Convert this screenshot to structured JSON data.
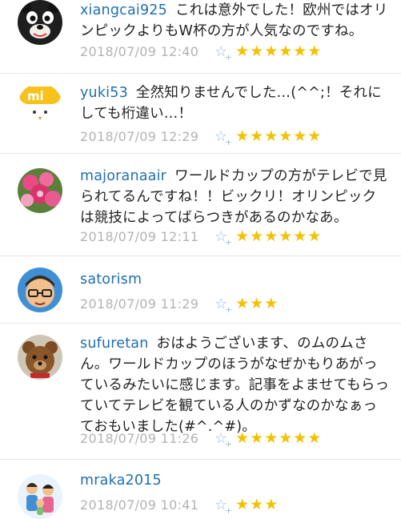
{
  "comments": [
    {
      "user": "xiangcai925",
      "text": "これは意外でした！欧州ではオリンピックよりもW杯の方が人気なのですね。",
      "date": "2018/07/09 12:40",
      "stars": "★★★★★★"
    },
    {
      "user": "yuki53",
      "text": "全然知りませんでした…(^^;！それにしても桁違い…！",
      "date": "2018/07/09 12:29",
      "stars": "★★★★★★"
    },
    {
      "user": "majoranaair",
      "text": "ワールドカップの方がテレビで見られてるんですね！！ビックリ！オリンピックは競技によってばらつきがあるのかなあ。",
      "date": "2018/07/09 12:11",
      "stars": "★★★★★★"
    },
    {
      "user": "satorism",
      "text": "",
      "date": "2018/07/09 11:29",
      "stars": "★★★"
    },
    {
      "user": "sufuretan",
      "text": "おはようございます、のムのムさん。ワールドカップのほうがなぜかもりあがっているみたいに感じます。記事をよませてもらっていてテレビを観ている人のかずなのかなぁっておもいました(#^.^#)。",
      "date": "2018/07/09 11:26",
      "stars": "★★★★★★"
    },
    {
      "user": "mraka2015",
      "text": "",
      "date": "2018/07/09 10:41",
      "stars": "★★★"
    }
  ],
  "avatar_icons": [
    "bear-avatar-icon",
    "mi-chick-avatar-icon",
    "flower-avatar-icon",
    "glasses-man-avatar-icon",
    "teddy-bear-avatar-icon",
    "family-avatar-icon"
  ],
  "colors": {
    "username": "#1f6fb0",
    "date": "#b3b3b3",
    "star": "#f2c200",
    "star_add": "#9bbbe0"
  }
}
